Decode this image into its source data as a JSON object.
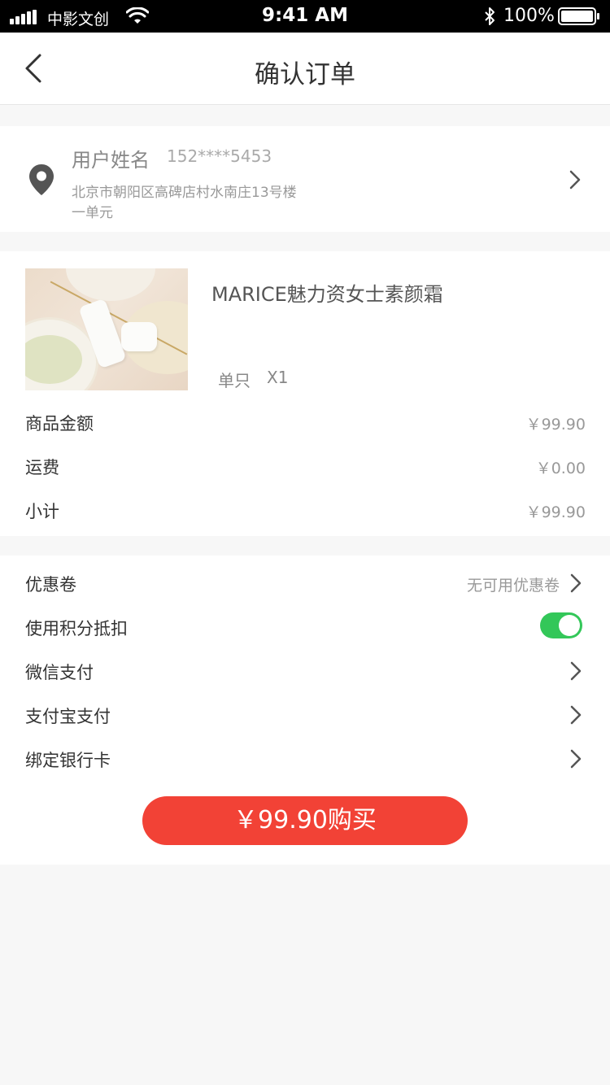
{
  "status_bar": {
    "carrier": "中影文创",
    "time": "9:41 AM",
    "battery": "100%"
  },
  "nav": {
    "title": "确认订单"
  },
  "address": {
    "name": "用户姓名",
    "phone": "152****5453",
    "line1": "北京市朝阳区高碑店村水南庄13号楼",
    "line2": "一单元"
  },
  "product": {
    "name": "MARICE魅力资女士素颜霜",
    "spec": "单只",
    "quantity": "X1"
  },
  "fees": [
    {
      "label": "商品金额",
      "value": "￥99.90"
    },
    {
      "label": "运费",
      "value": "￥0.00"
    },
    {
      "label": "小计",
      "value": "￥99.90"
    }
  ],
  "options": {
    "coupon_label": "优惠卷",
    "coupon_value": "无可用优惠卷",
    "points_label": "使用积分抵扣",
    "points_enabled": true,
    "wechat_pay_label": "微信支付",
    "alipay_label": "支付宝支付",
    "bind_card_label": "绑定银行卡"
  },
  "buy_button": {
    "label": "￥99.90购买"
  },
  "colors": {
    "accent": "#f24236",
    "toggle_on": "#33c759",
    "background": "#f7f7f7"
  }
}
